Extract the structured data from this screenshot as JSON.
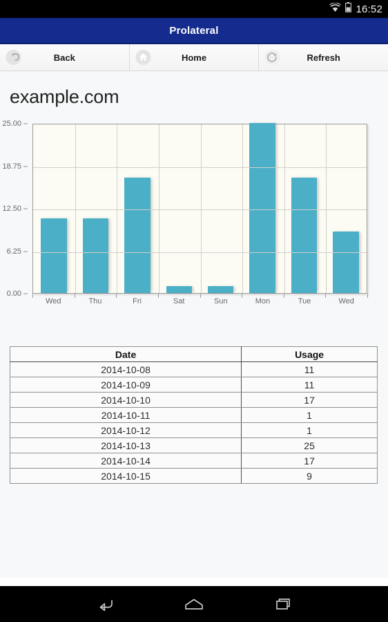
{
  "status_bar": {
    "clock": "16:52",
    "wifi_icon": "wifi-icon",
    "battery_icon": "battery-icon"
  },
  "title_bar": {
    "app_title": "Prolateral",
    "bg_color": "#152c8e"
  },
  "toolbar": {
    "buttons": [
      {
        "label": "Back",
        "icon": "back-arrow-icon"
      },
      {
        "label": "Home",
        "icon": "home-icon"
      },
      {
        "label": "Refresh",
        "icon": "refresh-icon"
      }
    ]
  },
  "main": {
    "page_title": "example.com",
    "accent_color": "#4bafc8"
  },
  "chart_data": {
    "type": "bar",
    "title": "example.com",
    "xlabel": "",
    "ylabel": "",
    "categories": [
      "Wed",
      "Thu",
      "Fri",
      "Sat",
      "Sun",
      "Mon",
      "Tue",
      "Wed"
    ],
    "values": [
      11,
      11,
      17,
      1,
      1,
      25,
      17,
      9
    ],
    "ylim": [
      0,
      25
    ],
    "yticks": [
      0,
      6.25,
      12.5,
      18.75,
      25
    ],
    "ytick_labels": [
      "0.00",
      "6.25",
      "12.50",
      "18.75",
      "25.00"
    ],
    "grid": true,
    "legend": "none",
    "bar_color": "#4bafc8",
    "plot_bg": "#fdfcf4"
  },
  "table": {
    "columns": [
      "Date",
      "Usage"
    ],
    "rows": [
      {
        "date": "2014-10-08",
        "usage": "11"
      },
      {
        "date": "2014-10-09",
        "usage": "11"
      },
      {
        "date": "2014-10-10",
        "usage": "17"
      },
      {
        "date": "2014-10-11",
        "usage": "1"
      },
      {
        "date": "2014-10-12",
        "usage": "1"
      },
      {
        "date": "2014-10-13",
        "usage": "25"
      },
      {
        "date": "2014-10-14",
        "usage": "17"
      },
      {
        "date": "2014-10-15",
        "usage": "9"
      }
    ]
  },
  "nav_bar": {
    "buttons": [
      {
        "icon": "android-back-icon"
      },
      {
        "icon": "android-home-icon"
      },
      {
        "icon": "android-recents-icon"
      }
    ]
  }
}
